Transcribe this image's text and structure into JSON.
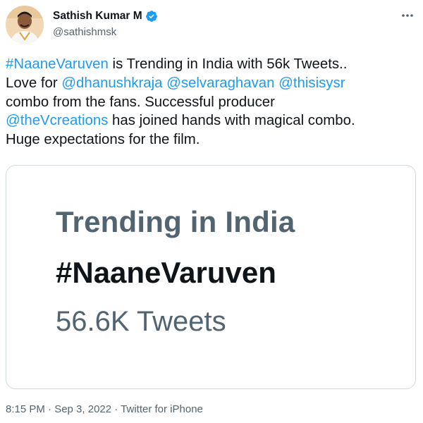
{
  "author": {
    "display_name": "Sathish Kumar M",
    "handle": "@sathishmsk",
    "verified": true,
    "avatar_icon": "user-avatar"
  },
  "tweet": {
    "lines": [
      [
        {
          "text": "#NaaneVaruven",
          "link": true
        },
        {
          "text": " is Trending in India with 56k Tweets..",
          "link": false
        }
      ],
      [
        {
          "text": "Love for ",
          "link": false
        },
        {
          "text": "@dhanushkraja",
          "link": true
        },
        {
          "text": " ",
          "link": false
        },
        {
          "text": "@selvaraghavan",
          "link": true
        },
        {
          "text": " ",
          "link": false
        },
        {
          "text": "@thisisysr",
          "link": true
        }
      ],
      [
        {
          "text": "combo from the fans. Successful producer",
          "link": false
        }
      ],
      [
        {
          "text": "@theVcreations",
          "link": true
        },
        {
          "text": " has joined hands with magical combo.",
          "link": false
        }
      ],
      [
        {
          "text": "Huge expectations for the film.",
          "link": false
        }
      ]
    ]
  },
  "card": {
    "title": "Trending in India",
    "hashtag": "#NaaneVaruven",
    "count": "56.6K Tweets"
  },
  "meta": {
    "text": "8:15 PM · Sep 3, 2022 · Twitter for iPhone"
  },
  "colors": {
    "link": "#1d9bf0",
    "text": "#0f1419",
    "secondary": "#536471",
    "border": "#cfd9de"
  },
  "icons": {
    "verified": "verified-badge-icon",
    "more": "more-options-icon"
  }
}
